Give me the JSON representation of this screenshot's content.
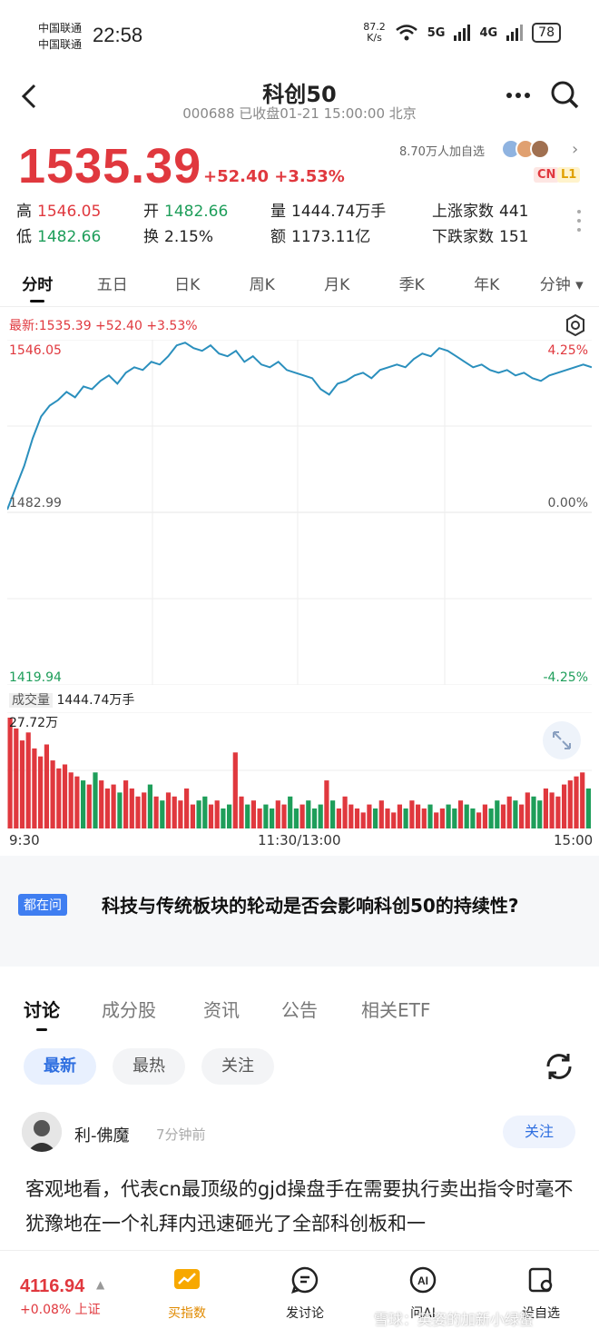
{
  "status": {
    "carrier1": "中国联通",
    "carrier2": "中国联通",
    "time": "22:58",
    "net_speed": "87.2",
    "net_unit": "K/s",
    "sig1": "5G",
    "sig2": "4G",
    "battery": "78"
  },
  "nav": {
    "title": "科创50",
    "subtitle": "000688 已收盘01-21 15:00:00 北京"
  },
  "quote": {
    "price": "1535.39",
    "change": "+52.40 +3.53%",
    "followers": "8.70万人加自选",
    "badge_cn": "CN",
    "badge_l1": "L1",
    "high_label": "高",
    "high": "1546.05",
    "open_label": "开",
    "open": "1482.66",
    "vol_label": "量",
    "vol": "1444.74万手",
    "up_label": "上涨家数",
    "up": "441",
    "low_label": "低",
    "low": "1482.66",
    "turn_label": "换",
    "turn": "2.15%",
    "amt_label": "额",
    "amt": "1173.11亿",
    "down_label": "下跌家数",
    "down": "151"
  },
  "kline_tabs": [
    "分时",
    "五日",
    "日K",
    "周K",
    "月K",
    "季K",
    "年K",
    "分钟 ▾"
  ],
  "chart_header": "最新:1535.39  +52.40  +3.53%",
  "volume_label": "成交量",
  "volume_value": "1444.74万手",
  "chart_data": {
    "type": "line",
    "price_ticks": {
      "top": "1546.05",
      "mid": "1482.99",
      "bottom": "1419.94"
    },
    "pct_ticks": {
      "top": "4.25%",
      "mid": "0.00%",
      "bottom": "-4.25%"
    },
    "ylim": [
      1419.94,
      1546.05
    ],
    "baseline": 1482.99,
    "x_labels": [
      "9:30",
      "11:30/13:00",
      "15:00"
    ],
    "price_series": [
      1484.0,
      1492,
      1500,
      1510,
      1518,
      1522,
      1524,
      1527,
      1525,
      1529,
      1528,
      1531,
      1533,
      1530,
      1534,
      1536,
      1535,
      1538,
      1537,
      1540,
      1544,
      1545,
      1543,
      1542,
      1544,
      1541,
      1540,
      1542,
      1538,
      1540,
      1537,
      1536,
      1538,
      1535,
      1534,
      1533,
      1532,
      1528,
      1526,
      1530,
      1531,
      1533,
      1534,
      1532,
      1535,
      1536,
      1537,
      1536,
      1539,
      1541,
      1540,
      1543,
      1542,
      1540,
      1538,
      1536,
      1537,
      1535,
      1534,
      1535,
      1533,
      1534,
      1532,
      1531,
      1533,
      1534,
      1535,
      1536,
      1537,
      1536
    ],
    "volume_max": "27.72万",
    "volume_series": [
      27.7,
      25,
      22,
      24,
      20,
      18,
      21,
      17,
      15,
      16,
      14,
      13,
      12,
      11,
      14,
      12,
      10,
      11,
      9,
      12,
      10,
      8,
      9,
      11,
      8,
      7,
      9,
      8,
      7,
      10,
      6,
      7,
      8,
      6,
      7,
      5,
      6,
      19,
      8,
      6,
      7,
      5,
      6,
      5,
      7,
      6,
      8,
      5,
      6,
      7,
      5,
      6,
      12,
      7,
      5,
      8,
      6,
      5,
      4,
      6,
      5,
      7,
      5,
      4,
      6,
      5,
      7,
      6,
      5,
      6,
      4,
      5,
      6,
      5,
      7,
      6,
      5,
      4,
      6,
      5,
      7,
      6,
      8,
      7,
      6,
      9,
      8,
      7,
      10,
      9,
      8,
      11,
      12,
      13,
      14,
      10
    ]
  },
  "question": {
    "tag": "都在问",
    "text": "科技与传统板块的轮动是否会影响科创50的持续性?"
  },
  "sub_tabs": [
    "讨论",
    "成分股",
    "资讯",
    "公告",
    "相关ETF"
  ],
  "sort_chips": [
    "最新",
    "最热",
    "关注"
  ],
  "post": {
    "author": "利-佛魔",
    "time": "7分钟前",
    "follow": "关注",
    "body": "客观地看，代表cn最顶级的gjd操盘手在需要执行卖出指令时毫不犹豫地在一个礼拜内迅速砸光了全部科创板和一"
  },
  "bottom": {
    "index_value": "4116.94",
    "index_arrow": "▲",
    "index_change": "+0.08% 上证",
    "buy": "买指数",
    "discuss": "发讨论",
    "ask": "问AI",
    "watch": "设自选"
  },
  "watermark": "雪球：英姿的加新小绿蟹",
  "colors": {
    "up": "#e0383e",
    "down": "#1e9e5a",
    "line": "#2a8fbd",
    "accent": "#2f6fe0"
  }
}
